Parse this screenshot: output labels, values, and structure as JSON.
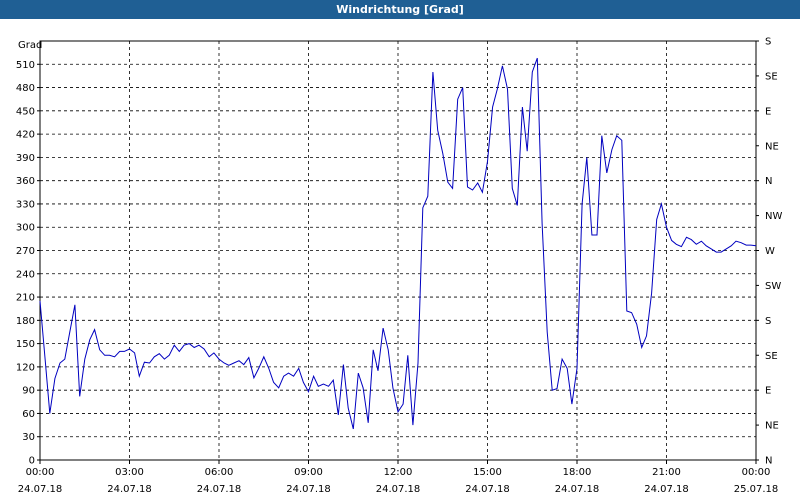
{
  "window": {
    "title": "Windrichtung [Grad]"
  },
  "chart_data": {
    "type": "line",
    "title": "Windrichtung [Grad]",
    "ylabel": "Grad",
    "ylim": [
      0,
      540
    ],
    "yticks": [
      0,
      30,
      60,
      90,
      120,
      150,
      180,
      210,
      240,
      270,
      300,
      330,
      360,
      390,
      420,
      450,
      480,
      510
    ],
    "right_axis_labels": [
      "N",
      "NE",
      "E",
      "SE",
      "S",
      "SW",
      "W",
      "NW",
      "N",
      "NE",
      "E",
      "SE",
      "S"
    ],
    "right_axis_values": [
      0,
      45,
      90,
      135,
      180,
      225,
      270,
      315,
      360,
      405,
      450,
      495,
      540
    ],
    "xlim_hours": [
      0,
      24
    ],
    "xticks": [
      {
        "hour": 0,
        "time": "00:00",
        "date": "24.07.18"
      },
      {
        "hour": 3,
        "time": "03:00",
        "date": "24.07.18"
      },
      {
        "hour": 6,
        "time": "06:00",
        "date": "24.07.18"
      },
      {
        "hour": 9,
        "time": "09:00",
        "date": "24.07.18"
      },
      {
        "hour": 12,
        "time": "12:00",
        "date": "24.07.18"
      },
      {
        "hour": 15,
        "time": "15:00",
        "date": "24.07.18"
      },
      {
        "hour": 18,
        "time": "18:00",
        "date": "24.07.18"
      },
      {
        "hour": 21,
        "time": "21:00",
        "date": "24.07.18"
      },
      {
        "hour": 24,
        "time": "00:00",
        "date": "25.07.18"
      }
    ],
    "grid": true,
    "line_color": "#0000c0",
    "series": [
      {
        "name": "",
        "points": [
          [
            0.0,
            205
          ],
          [
            0.17,
            130
          ],
          [
            0.33,
            60
          ],
          [
            0.5,
            105
          ],
          [
            0.67,
            125
          ],
          [
            0.83,
            130
          ],
          [
            1.0,
            165
          ],
          [
            1.17,
            200
          ],
          [
            1.33,
            82
          ],
          [
            1.5,
            130
          ],
          [
            1.67,
            155
          ],
          [
            1.83,
            168
          ],
          [
            2.0,
            142
          ],
          [
            2.17,
            135
          ],
          [
            2.33,
            135
          ],
          [
            2.5,
            133
          ],
          [
            2.67,
            140
          ],
          [
            2.83,
            140
          ],
          [
            3.0,
            143
          ],
          [
            3.17,
            138
          ],
          [
            3.33,
            108
          ],
          [
            3.5,
            126
          ],
          [
            3.67,
            125
          ],
          [
            3.83,
            133
          ],
          [
            4.0,
            137
          ],
          [
            4.17,
            130
          ],
          [
            4.33,
            135
          ],
          [
            4.5,
            148
          ],
          [
            4.67,
            140
          ],
          [
            4.83,
            148
          ],
          [
            5.0,
            150
          ],
          [
            5.17,
            145
          ],
          [
            5.33,
            148
          ],
          [
            5.5,
            143
          ],
          [
            5.67,
            133
          ],
          [
            5.83,
            138
          ],
          [
            6.0,
            130
          ],
          [
            6.17,
            125
          ],
          [
            6.33,
            122
          ],
          [
            6.5,
            125
          ],
          [
            6.67,
            128
          ],
          [
            6.83,
            123
          ],
          [
            7.0,
            132
          ],
          [
            7.17,
            106
          ],
          [
            7.33,
            118
          ],
          [
            7.5,
            133
          ],
          [
            7.67,
            118
          ],
          [
            7.83,
            100
          ],
          [
            8.0,
            93
          ],
          [
            8.17,
            108
          ],
          [
            8.33,
            112
          ],
          [
            8.5,
            108
          ],
          [
            8.67,
            118
          ],
          [
            8.83,
            100
          ],
          [
            9.0,
            88
          ],
          [
            9.17,
            108
          ],
          [
            9.33,
            95
          ],
          [
            9.5,
            98
          ],
          [
            9.67,
            95
          ],
          [
            9.83,
            103
          ],
          [
            10.0,
            58
          ],
          [
            10.17,
            123
          ],
          [
            10.33,
            67
          ],
          [
            10.5,
            40
          ],
          [
            10.67,
            112
          ],
          [
            10.83,
            93
          ],
          [
            11.0,
            48
          ],
          [
            11.17,
            142
          ],
          [
            11.33,
            115
          ],
          [
            11.5,
            170
          ],
          [
            11.67,
            142
          ],
          [
            11.83,
            93
          ],
          [
            12.0,
            62
          ],
          [
            12.17,
            72
          ],
          [
            12.33,
            135
          ],
          [
            12.5,
            45
          ],
          [
            12.67,
            125
          ],
          [
            12.83,
            325
          ],
          [
            13.0,
            340
          ],
          [
            13.17,
            500
          ],
          [
            13.33,
            425
          ],
          [
            13.5,
            395
          ],
          [
            13.67,
            358
          ],
          [
            13.83,
            350
          ],
          [
            14.0,
            465
          ],
          [
            14.17,
            480
          ],
          [
            14.33,
            352
          ],
          [
            14.5,
            348
          ],
          [
            14.67,
            357
          ],
          [
            14.83,
            345
          ],
          [
            15.0,
            385
          ],
          [
            15.17,
            455
          ],
          [
            15.33,
            478
          ],
          [
            15.5,
            508
          ],
          [
            15.67,
            478
          ],
          [
            15.83,
            350
          ],
          [
            16.0,
            328
          ],
          [
            16.17,
            455
          ],
          [
            16.33,
            398
          ],
          [
            16.5,
            500
          ],
          [
            16.67,
            518
          ],
          [
            16.83,
            305
          ],
          [
            17.0,
            165
          ],
          [
            17.17,
            90
          ],
          [
            17.33,
            92
          ],
          [
            17.5,
            130
          ],
          [
            17.67,
            118
          ],
          [
            17.83,
            72
          ],
          [
            18.0,
            118
          ],
          [
            18.17,
            330
          ],
          [
            18.33,
            390
          ],
          [
            18.5,
            290
          ],
          [
            18.67,
            290
          ],
          [
            18.83,
            418
          ],
          [
            19.0,
            370
          ],
          [
            19.17,
            400
          ],
          [
            19.33,
            418
          ],
          [
            19.5,
            412
          ],
          [
            19.67,
            192
          ],
          [
            19.83,
            190
          ],
          [
            20.0,
            175
          ],
          [
            20.17,
            145
          ],
          [
            20.33,
            160
          ],
          [
            20.5,
            215
          ],
          [
            20.67,
            310
          ],
          [
            20.83,
            330
          ],
          [
            21.0,
            300
          ],
          [
            21.17,
            283
          ],
          [
            21.33,
            278
          ],
          [
            21.5,
            275
          ],
          [
            21.67,
            287
          ],
          [
            21.83,
            284
          ],
          [
            22.0,
            278
          ],
          [
            22.17,
            282
          ],
          [
            22.33,
            276
          ],
          [
            22.5,
            272
          ],
          [
            22.67,
            268
          ],
          [
            22.83,
            268
          ],
          [
            23.0,
            272
          ],
          [
            23.17,
            276
          ],
          [
            23.33,
            282
          ],
          [
            23.5,
            280
          ],
          [
            23.67,
            277
          ],
          [
            23.83,
            277
          ],
          [
            24.0,
            276
          ]
        ]
      }
    ]
  }
}
